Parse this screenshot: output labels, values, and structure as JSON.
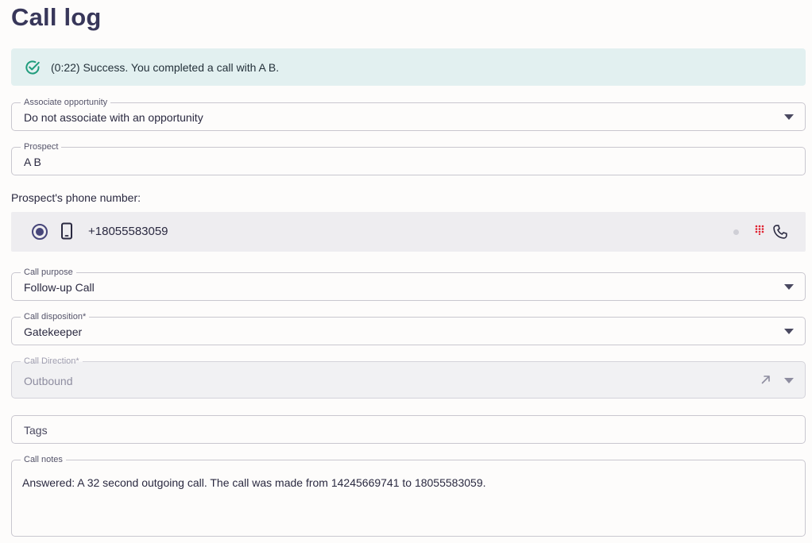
{
  "page": {
    "title": "Call log"
  },
  "alert": {
    "icon": "check-circle-icon",
    "message": "(0:22) Success. You completed a call with A B.",
    "color": "#1f9c7c"
  },
  "associate_opportunity": {
    "label": "Associate opportunity",
    "value": "Do not associate with an opportunity"
  },
  "prospect": {
    "label": "Prospect",
    "value": "A B"
  },
  "phone": {
    "label": "Prospect's phone number:",
    "number": "+18055583059",
    "selected": true,
    "icons": [
      "mobile-phone-icon",
      "status-dot",
      "dialpad-icon",
      "call-icon"
    ],
    "dialpad_color": "#e0202e"
  },
  "call_purpose": {
    "label": "Call purpose",
    "value": "Follow-up Call"
  },
  "call_disposition": {
    "label": "Call disposition*",
    "value": "Gatekeeper"
  },
  "call_direction": {
    "label": "Call Direction*",
    "value": "Outbound",
    "disabled": true,
    "icon": "outbound-arrow-icon"
  },
  "tags": {
    "placeholder": "Tags"
  },
  "call_notes": {
    "label": "Call notes",
    "value": "Answered: A 32 second outgoing call. The call was made from 14245669741 to 18055583059."
  }
}
